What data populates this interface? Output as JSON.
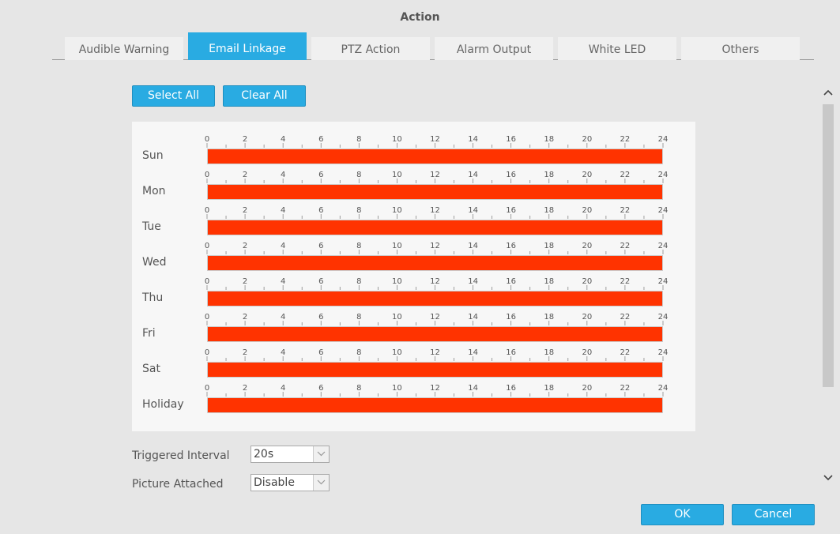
{
  "dialog": {
    "title": "Action"
  },
  "tabs": [
    {
      "label": "Audible Warning",
      "active": false
    },
    {
      "label": "Email Linkage",
      "active": true
    },
    {
      "label": "PTZ Action",
      "active": false
    },
    {
      "label": "Alarm Output",
      "active": false
    },
    {
      "label": "White LED",
      "active": false
    },
    {
      "label": "Others",
      "active": false
    }
  ],
  "toolbar": {
    "select_all": "Select All",
    "clear_all": "Clear All"
  },
  "schedule": {
    "days": [
      "Sun",
      "Mon",
      "Tue",
      "Wed",
      "Thu",
      "Fri",
      "Sat",
      "Holiday"
    ],
    "hour_ticks": [
      "0",
      "2",
      "4",
      "6",
      "8",
      "10",
      "12",
      "14",
      "16",
      "18",
      "20",
      "22",
      "24"
    ],
    "fill_color": "#ff3300",
    "ranges": [
      [
        0,
        24
      ],
      [
        0,
        24
      ],
      [
        0,
        24
      ],
      [
        0,
        24
      ],
      [
        0,
        24
      ],
      [
        0,
        24
      ],
      [
        0,
        24
      ],
      [
        0,
        24
      ]
    ]
  },
  "form": {
    "triggered_interval": {
      "label": "Triggered Interval",
      "value": "20s"
    },
    "picture_attached": {
      "label": "Picture Attached",
      "value": "Disable"
    }
  },
  "footer": {
    "ok": "OK",
    "cancel": "Cancel"
  },
  "colors": {
    "accent": "#29abe2",
    "background": "#e6e6e6"
  },
  "icons": {
    "scroll_up": "chevron-up-icon",
    "scroll_down": "chevron-down-icon",
    "dropdown": "chevron-down-icon"
  }
}
